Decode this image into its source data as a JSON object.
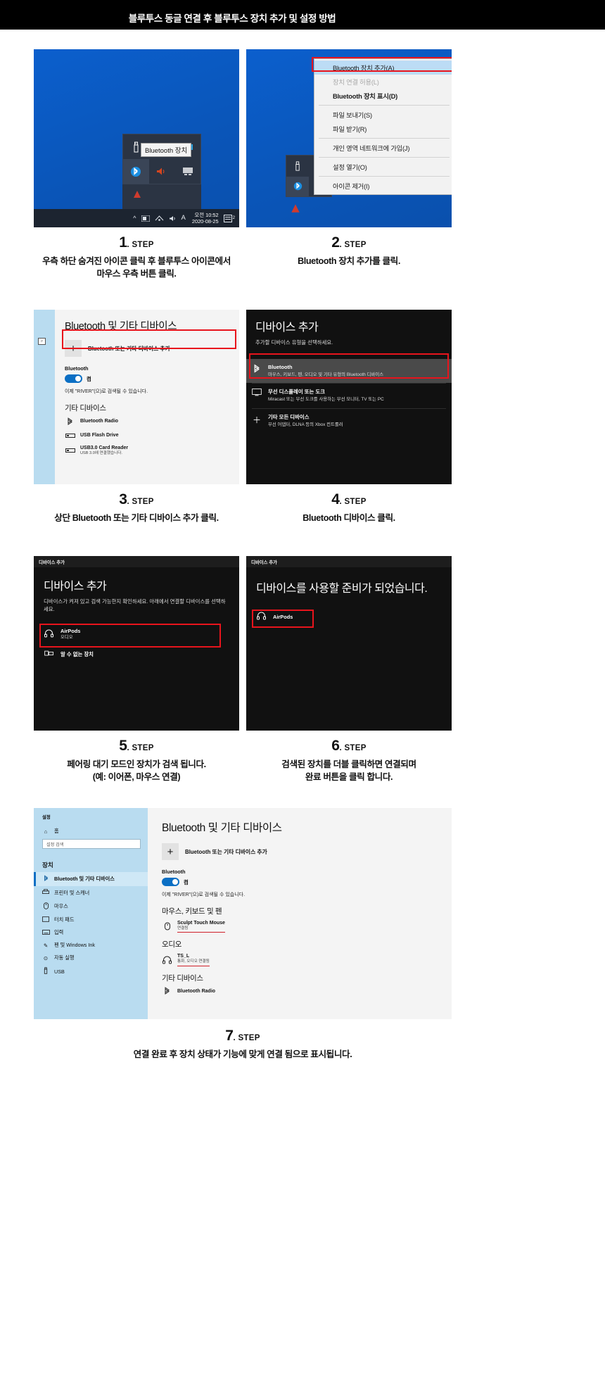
{
  "page": {
    "title": "블루투스 동글 연결 후 블루투스 장치 추가 및 설정 방법"
  },
  "steps": [
    {
      "number": "1",
      "step_label": ". STEP",
      "description": "우측 하단 숨겨진 아이콘 클릭 후 블루투스 아이콘에서\n마우스 우측 버튼 클릭."
    },
    {
      "number": "2",
      "step_label": ". STEP",
      "description": "Bluetooth 장치 추가를 클릭."
    },
    {
      "number": "3",
      "step_label": ". STEP",
      "description": "상단 Bluetooth 또는 기타 디바이스 추가 클릭."
    },
    {
      "number": "4",
      "step_label": ". STEP",
      "description": "Bluetooth 디바이스 클릭."
    },
    {
      "number": "5",
      "step_label": ". STEP",
      "description": "페어링 대기 모드인 장치가 검색 됩니다.\n(예: 이어폰, 마우스 연결)"
    },
    {
      "number": "6",
      "step_label": ". STEP",
      "description": "검색된 장치를 더블 클릭하면 연결되며\n완료 버튼을 클릭 합니다."
    },
    {
      "number": "7",
      "step_label": ". STEP",
      "description": "연결 완료 후 장치 상태가 기능에 맞게 연결 됨으로 표시됩니다."
    }
  ],
  "shot1": {
    "tooltip": "Bluetooth 장치",
    "tray_icons": [
      "usb-icon",
      "network-icon",
      "printer-icon",
      "bluetooth-icon",
      "volume-icon",
      "display-icon"
    ],
    "taskbar": {
      "chevron": "^",
      "icons": [
        "tray-up-icon",
        "network-icon",
        "volume-icon",
        "ime-icon"
      ],
      "ime": "A",
      "time": "오전 10:52",
      "date": "2020-08-25",
      "notify": "2"
    }
  },
  "shot2": {
    "menu": [
      {
        "label": "Bluetooth 장치 추가(A)",
        "state": "selected"
      },
      {
        "label": "장치 연결 허용(L)",
        "state": "disabled"
      },
      {
        "label": "Bluetooth 장치 표시(D)",
        "state": "bold"
      },
      {
        "label": "파일 보내기(S)",
        "state": "normal"
      },
      {
        "label": "파일 받기(R)",
        "state": "normal"
      },
      {
        "label": "개인 영역 네트워크에 가입(J)",
        "state": "normal"
      },
      {
        "label": "설정 열기(O)",
        "state": "normal"
      },
      {
        "label": "아이콘 제거(I)",
        "state": "normal"
      }
    ]
  },
  "shot3": {
    "heading": "Bluetooth 및 기타 디바이스",
    "add_label": "Bluetooth 또는 기타 디바이스 추가",
    "plus": "+",
    "bluetooth_label": "Bluetooth",
    "toggle_text": "켬",
    "hint": "이제 \"RIVER\"(으)로 검색될 수 있습니다.",
    "other_group": "기타 디바이스",
    "devices": [
      {
        "name": "Bluetooth Radio",
        "sub": "",
        "icon": "bluetooth-icon"
      },
      {
        "name": "USB Flash Drive",
        "sub": "",
        "icon": "usb-icon"
      },
      {
        "name": "USB3.0 Card Reader",
        "sub": "USB 3.0에 연결했습니다.",
        "icon": "usb-icon"
      }
    ],
    "search_icon": "search-icon"
  },
  "shot4": {
    "titlebar": "",
    "heading": "디바이스 추가",
    "subheading": "추가할 디바이스 유형을 선택하세요.",
    "options": [
      {
        "title": "Bluetooth",
        "sub": "마우스, 키보드, 펜, 오디오 및 기타 유형의 Bluetooth 디바이스",
        "icon": "bluetooth-icon",
        "highlighted": true
      },
      {
        "title": "무선 디스플레이 또는 도크",
        "sub": "Miracast 또는 무선 도크를 사용하는 무선 모니터, TV 또는 PC",
        "icon": "display-icon",
        "highlighted": false
      },
      {
        "title": "기타 모든 디바이스",
        "sub": "무선 어댑터, DLNA 등의 Xbox 컨트롤러",
        "icon": "plus-icon",
        "highlighted": false
      }
    ]
  },
  "shot5": {
    "titlebar": "디바이스 추가",
    "heading": "디바이스 추가",
    "subheading": "디바이스가 켜져 있고 검색 가능한지 확인하세요. 아래에서 연결할 디바이스를 선택하세요.",
    "devices": [
      {
        "name": "AirPods",
        "sub": "오디오",
        "icon": "headphone-icon",
        "boxed": true
      },
      {
        "name": "알 수 없는 장치",
        "sub": "",
        "icon": "unknown-device-icon",
        "boxed": false
      }
    ]
  },
  "shot6": {
    "titlebar": "디바이스 추가",
    "heading": "디바이스를 사용할 준비가 되었습니다.",
    "devices": [
      {
        "name": "AirPods",
        "sub": "",
        "icon": "headphone-icon",
        "boxed": true
      }
    ]
  },
  "shot7": {
    "sidebar": {
      "title": "설정",
      "home": "홈",
      "home_icon": "home-icon",
      "search_placeholder": "설정 검색",
      "search_icon": "search-icon",
      "group": "장치",
      "items": [
        {
          "label": "Bluetooth 및 기타 디바이스",
          "icon": "bluetooth-icon",
          "selected": true
        },
        {
          "label": "프린터 및 스캐너",
          "icon": "printer-icon",
          "selected": false
        },
        {
          "label": "마우스",
          "icon": "mouse-icon",
          "selected": false
        },
        {
          "label": "터치 패드",
          "icon": "touchpad-icon",
          "selected": false
        },
        {
          "label": "입력",
          "icon": "keyboard-icon",
          "selected": false
        },
        {
          "label": "펜 및 Windows Ink",
          "icon": "pen-icon",
          "selected": false
        },
        {
          "label": "자동 실행",
          "icon": "autoplay-icon",
          "selected": false
        },
        {
          "label": "USB",
          "icon": "usb-icon",
          "selected": false
        }
      ]
    },
    "main": {
      "heading": "Bluetooth 및 기타 디바이스",
      "add_label": "Bluetooth 또는 기타 디바이스 추가",
      "plus": "+",
      "bluetooth_label": "Bluetooth",
      "toggle_text": "켬",
      "hint": "이제 \"RIVER\"(으)로 검색될 수 있습니다.",
      "groups": [
        {
          "title": "마우스, 키보드 및 펜",
          "devices": [
            {
              "name": "Sculpt Touch Mouse",
              "sub": "연결됨",
              "icon": "mouse-icon",
              "underlined": true
            }
          ]
        },
        {
          "title": "오디오",
          "devices": [
            {
              "name": "TS_L",
              "sub": "통화, 오디오 연결됨",
              "icon": "headphone-icon",
              "underlined": true
            }
          ]
        },
        {
          "title": "기타 디바이스",
          "devices": [
            {
              "name": "Bluetooth Radio",
              "sub": "",
              "icon": "bluetooth-icon",
              "underlined": false
            }
          ]
        }
      ]
    }
  },
  "colors": {
    "accent_red": "#e8141c",
    "windows_blue": "#0b6fc4",
    "desktop_blue": "#0a5bc4",
    "dark_panel": "#111111",
    "sidebar_blue": "#b9dcf0"
  }
}
